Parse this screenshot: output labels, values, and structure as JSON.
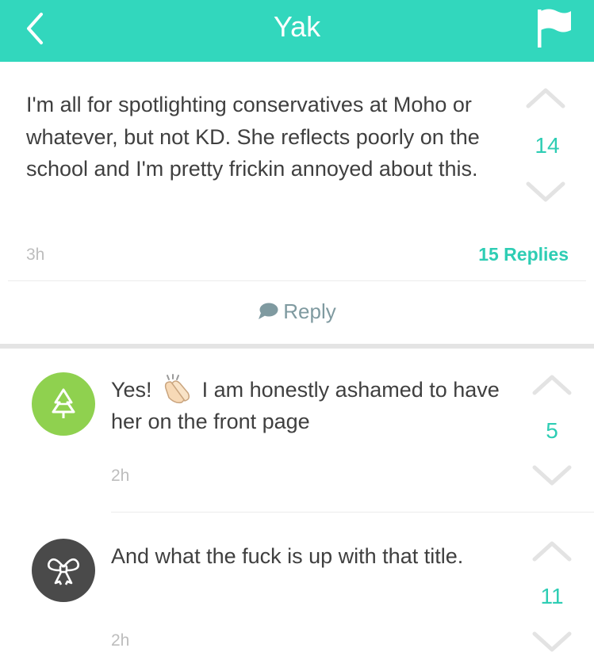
{
  "header": {
    "title": "Yak",
    "back_icon": "chevron-left-icon",
    "flag_icon": "flag-icon"
  },
  "post": {
    "text": "I'm all for spotlighting conservatives at Moho or whatever, but not KD. She reflects poorly on the school and I'm pretty frickin annoyed about this.",
    "votes": "14",
    "time": "3h",
    "replies": "15 Replies",
    "reply_label": "Reply"
  },
  "comments": [
    {
      "text_before": "Yes!",
      "emoji": "clapping-hands-icon",
      "text_after": "I am honestly ashamed to have her on the front page",
      "votes": "5",
      "time": "2h",
      "avatar_icon": "tree-icon",
      "avatar_color": "#8fd14f"
    },
    {
      "text": "And what the fuck is up with that title.",
      "votes": "11",
      "time": "2h",
      "avatar_icon": "bow-icon",
      "avatar_color": "#4a4a4a"
    }
  ],
  "colors": {
    "accent": "#32d7bd",
    "vote_count": "#2ecdb4",
    "arrow": "#e3e3e3"
  }
}
